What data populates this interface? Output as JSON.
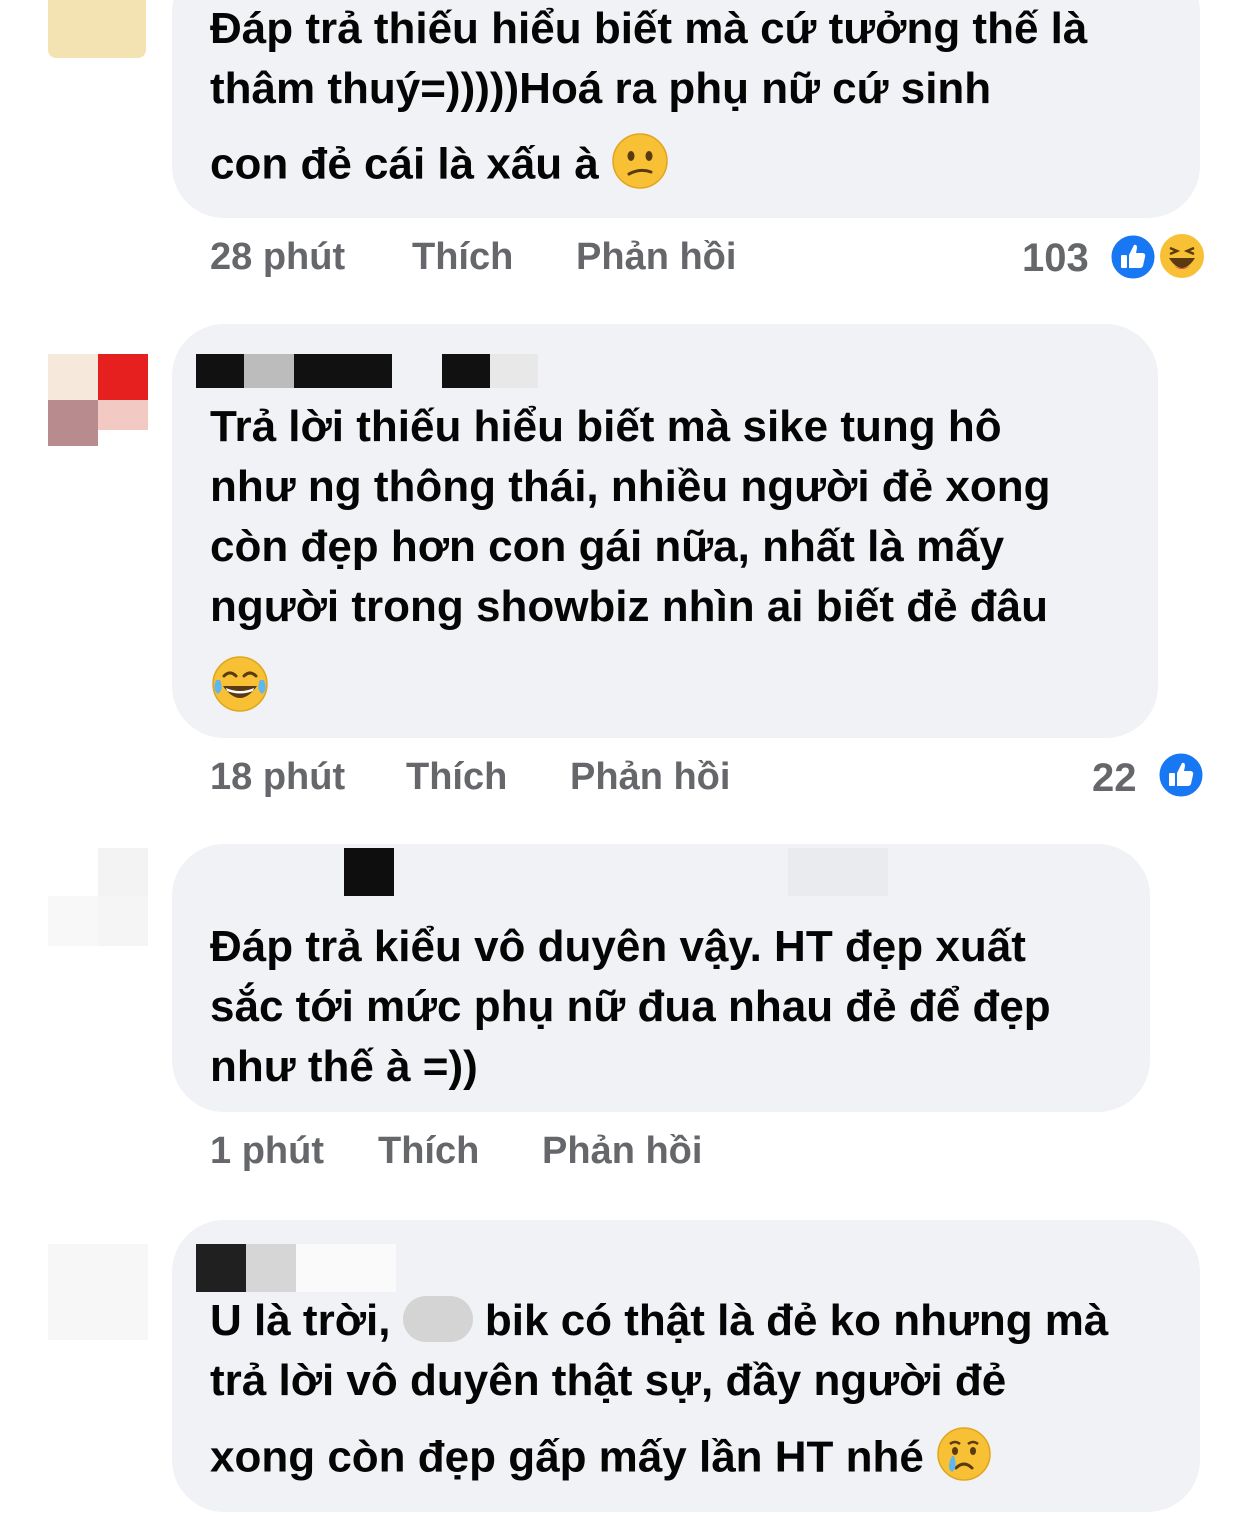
{
  "comments": [
    {
      "lines": [
        "Đáp trả thiếu hiểu biết mà cứ tưởng thế là",
        "thâm thuý=)))))Hoá ra phụ nữ cứ sinh",
        "con đẻ cái là xấu à"
      ],
      "time": "28 phút",
      "like_label": "Thích",
      "reply_label": "Phản hồi",
      "reaction_count": "103",
      "reactions": [
        "like-icon",
        "haha-icon"
      ],
      "end_emoji": "confused-face-icon"
    },
    {
      "lines": [
        "Trả lời thiếu hiểu biết mà sike tung hô",
        "như ng thông thái, nhiều người đẻ xong",
        "còn đẹp hơn con gái nữa, nhất là mấy",
        "người trong showbiz nhìn ai biết đẻ đâu"
      ],
      "time": "18 phút",
      "like_label": "Thích",
      "reply_label": "Phản hồi",
      "reaction_count": "22",
      "reactions": [
        "like-icon"
      ],
      "end_emoji": "tears-of-joy-icon"
    },
    {
      "lines": [
        "Đáp trả kiểu vô duyên vậy. HT đẹp xuất",
        "sắc tới mức phụ nữ đua nhau đẻ để đẹp",
        "như thế à =))"
      ],
      "time": "1 phút",
      "like_label": "Thích",
      "reply_label": "Phản hồi"
    },
    {
      "line1_start": "U là trời,",
      "line1_end": "bik có thật là đẻ ko nhưng mà",
      "lines": [
        "trả lời vô duyên thật sự, đầy người đẻ",
        "xong còn đẹp gấp mấy lần HT nhé"
      ],
      "end_emoji": "crying-face-icon"
    }
  ],
  "colors": {
    "bubble": "#f0f2f5",
    "meta_text": "#65676b",
    "like_blue": "#1877f2",
    "emoji_yellow": "#f7c035"
  }
}
